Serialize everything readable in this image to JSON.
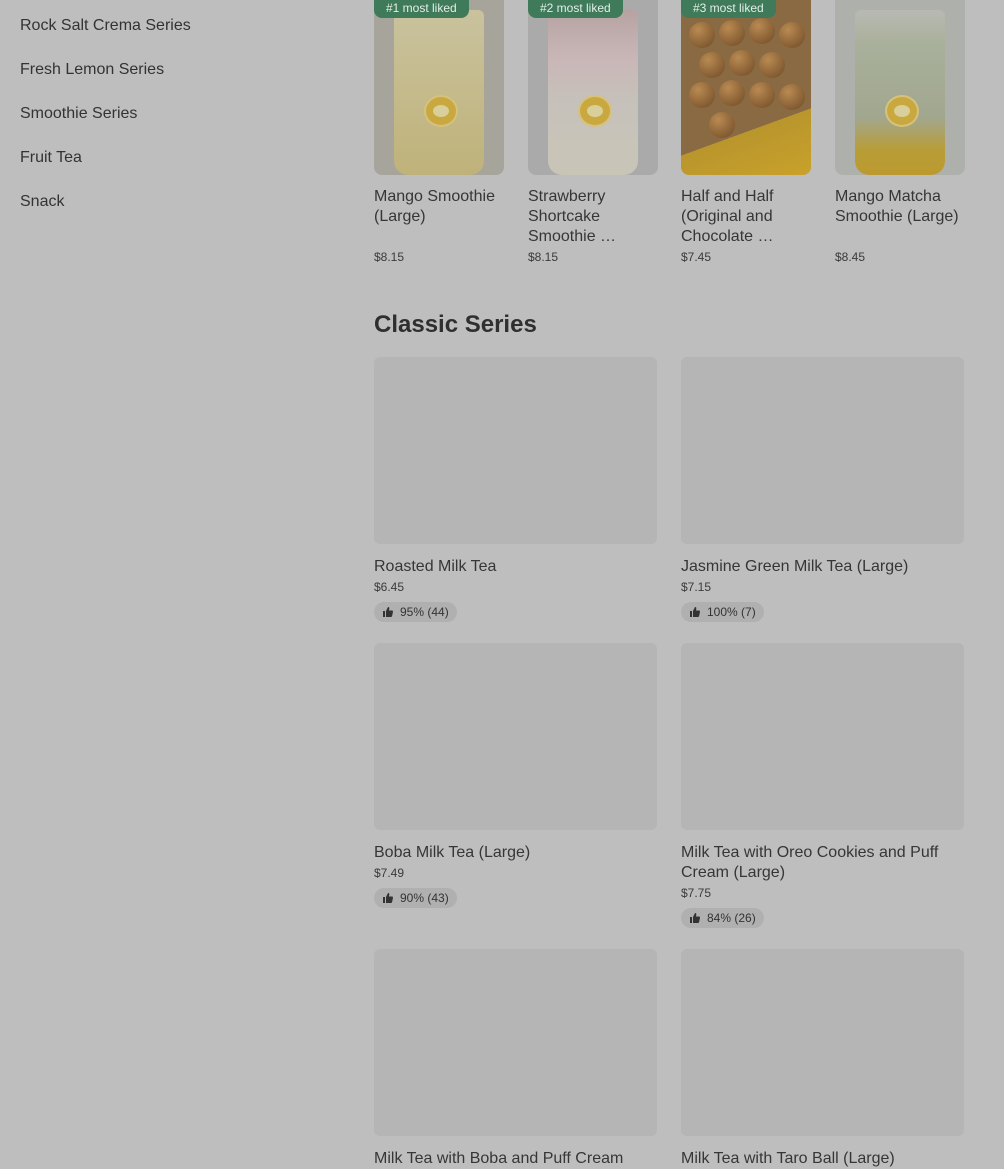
{
  "sidebar": {
    "items": [
      {
        "label": "Rock Salt Crema Series"
      },
      {
        "label": "Fresh Lemon Series"
      },
      {
        "label": "Smoothie Series"
      },
      {
        "label": "Fruit Tea"
      },
      {
        "label": "Snack"
      }
    ]
  },
  "featured": [
    {
      "badge": "#1 most liked",
      "name": "Mango Smoothie (Large)",
      "price": "$8.15"
    },
    {
      "badge": "#2 most liked",
      "name": "Strawberry Shortcake Smoothie …",
      "price": "$8.15"
    },
    {
      "badge": "#3 most liked",
      "name": "Half and Half (Original and Chocolate …",
      "price": "$7.45"
    },
    {
      "badge": "",
      "name": "Mango Matcha Smoothie (Large)",
      "price": "$8.45"
    }
  ],
  "section": {
    "title": "Classic Series"
  },
  "products": [
    {
      "name": "Roasted Milk Tea",
      "price": "$6.45",
      "rating": "95% (44)"
    },
    {
      "name": "Jasmine Green Milk Tea (Large)",
      "price": "$7.15",
      "rating": "100% (7)"
    },
    {
      "name": "Boba Milk Tea (Large)",
      "price": "$7.49",
      "rating": "90% (43)"
    },
    {
      "name": "Milk Tea with Oreo Cookies and Puff Cream (Large)",
      "price": "$7.75",
      "rating": "84% (26)"
    },
    {
      "name": "Milk Tea with Boba and Puff Cream",
      "price": "",
      "rating": ""
    },
    {
      "name": "Milk Tea with Taro Ball (Large)",
      "price": "",
      "rating": ""
    }
  ],
  "icons": {
    "rating": "thumbs-up-icon"
  },
  "colors": {
    "badge_bg": "#3f7a5a",
    "overlay": "#bebebe"
  }
}
